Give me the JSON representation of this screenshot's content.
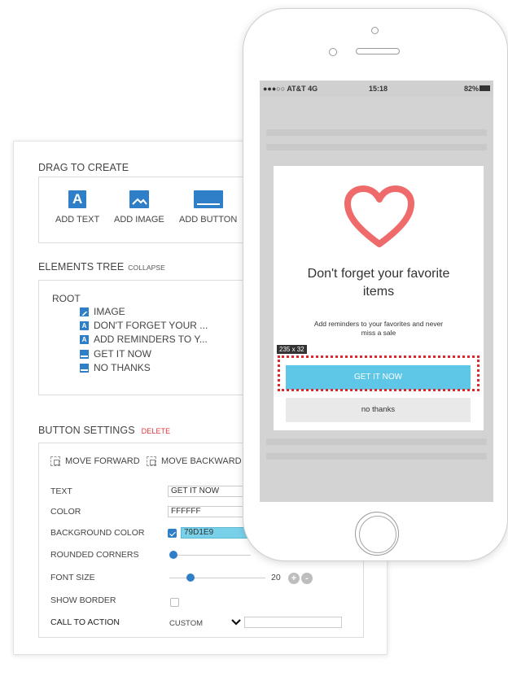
{
  "editor": {
    "drag_title": "DRAG TO CREATE",
    "tools": [
      {
        "label": "ADD TEXT",
        "icon": "text-icon",
        "glyph": "A"
      },
      {
        "label": "ADD IMAGE",
        "icon": "image-icon"
      },
      {
        "label": "ADD BUTTON",
        "icon": "button-icon"
      }
    ],
    "tree_title": "ELEMENTS TREE",
    "tree_collapse": "COLLAPSE",
    "tree_root": "ROOT",
    "tree_items": [
      {
        "label": "IMAGE",
        "icon": "image-icon"
      },
      {
        "label": "DON'T FORGET YOUR ...",
        "icon": "text-icon",
        "glyph": "A"
      },
      {
        "label": "ADD REMINDERS TO Y...",
        "icon": "text-icon",
        "glyph": "A"
      },
      {
        "label": "GET IT NOW",
        "icon": "button-icon"
      },
      {
        "label": "NO THANKS",
        "icon": "button-icon"
      }
    ],
    "settings_title": "BUTTON SETTINGS",
    "settings_delete": "DELETE",
    "move_forward": "MOVE FORWARD",
    "move_backward": "MOVE BACKWARD",
    "fields": {
      "text_label": "TEXT",
      "text_value": "GET IT NOW",
      "color_label": "COLOR",
      "color_value": "FFFFFF",
      "bg_label": "BACKGROUND COLOR",
      "bg_value": "79D1E9",
      "rounded_label": "ROUNDED CORNERS",
      "font_label": "FONT SIZE",
      "font_value": "20",
      "border_label": "SHOW BORDER",
      "cta_label": "CALL TO ACTION",
      "cta_value": "CUSTOM"
    },
    "stepper_plus": "+",
    "stepper_minus": "-",
    "accent_color": "#2e7fc7"
  },
  "phone": {
    "status": {
      "carrier": "●●●○○ AT&T  4G",
      "time": "15:18",
      "battery": "82%"
    },
    "modal": {
      "title_line1": "Don't forget your favorite",
      "title_line2": "items",
      "subtitle": "Add reminders to your favorites and never miss a sale",
      "dimension_badge": "235 x 32",
      "cta_label": "GET IT NOW",
      "secondary_label": "no thanks",
      "heart_color": "#ef6b6b",
      "cta_color": "#5ec7e8"
    }
  }
}
